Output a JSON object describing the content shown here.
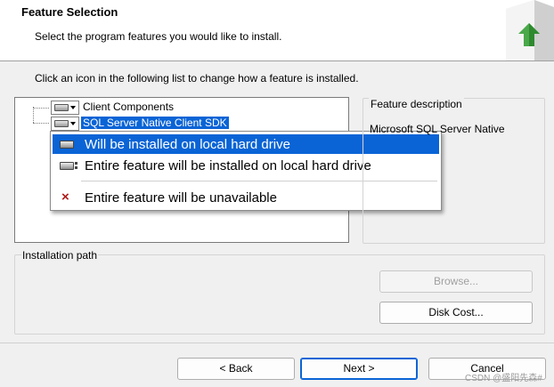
{
  "header": {
    "title": "Feature Selection",
    "subtitle": "Select the program features you would like to install."
  },
  "instruction": "Click an icon in the following list to change how a feature is installed.",
  "tree": {
    "items": [
      {
        "label": "Client Components",
        "icon": "hard-drive-icon",
        "selected": false
      },
      {
        "label": "SQL Server Native Client SDK",
        "icon": "hard-drive-icon",
        "selected": true
      }
    ]
  },
  "context_menu": {
    "items": [
      {
        "label": "Will be installed on local hard drive",
        "icon": "hard-drive-icon",
        "highlighted": true
      },
      {
        "label": "Entire feature will be installed on local hard drive",
        "icon": "hard-drive-full-icon",
        "highlighted": false
      },
      {
        "label": "Entire feature will be unavailable",
        "icon": "red-x-icon",
        "highlighted": false
      }
    ]
  },
  "feature_description": {
    "title": "Feature description",
    "text": "Microsoft SQL Server Native"
  },
  "installation_path": {
    "title": "Installation path",
    "browse_label": "Browse...",
    "disk_cost_label": "Disk Cost..."
  },
  "footer": {
    "back_label": "< Back",
    "next_label": "Next >",
    "cancel_label": "Cancel"
  },
  "watermark": "CSDN @盛阳先森#"
}
